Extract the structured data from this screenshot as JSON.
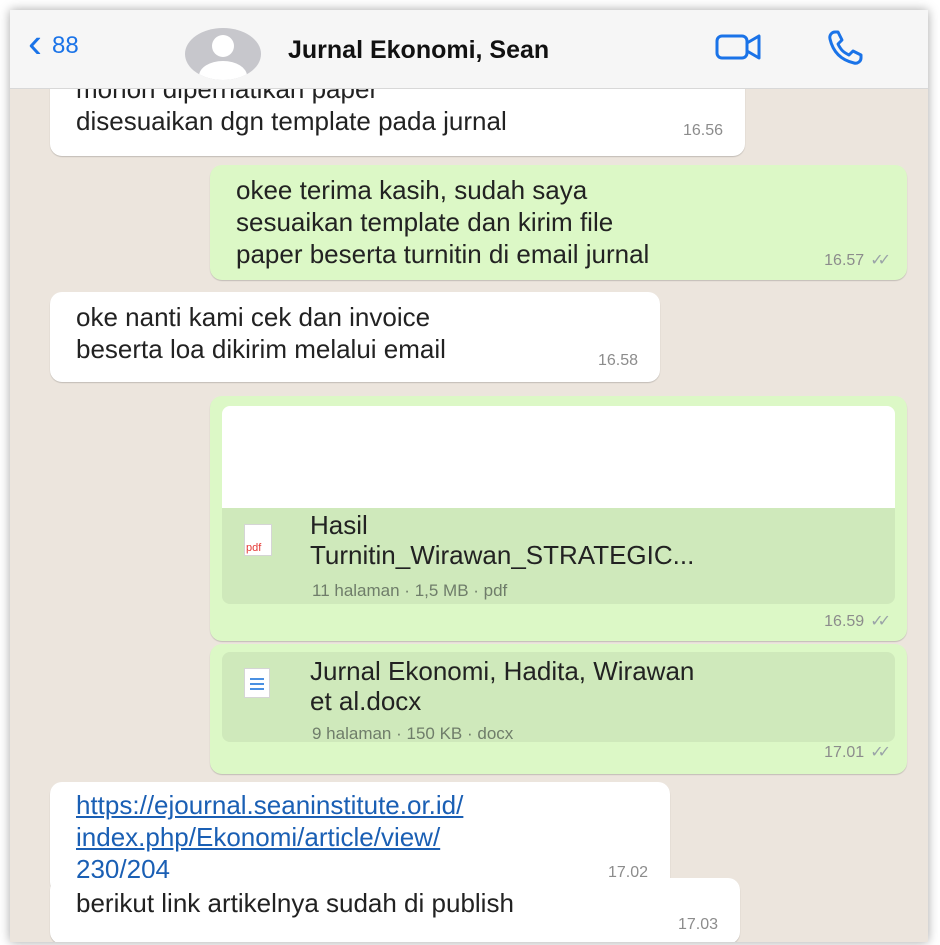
{
  "header": {
    "back_count": "88",
    "title": "Jurnal Ekonomi, Sean"
  },
  "messages": [
    {
      "type": "in",
      "lines": [
        "mohon diperhatikan paper",
        "disesuaikan dgn template pada jurnal"
      ],
      "time": "16.56"
    },
    {
      "type": "out",
      "lines": [
        "okee terima kasih, sudah saya",
        "sesuaikan template dan kirim file",
        "paper beserta turnitin di email jurnal"
      ],
      "time": "16.57"
    },
    {
      "type": "in",
      "lines": [
        "oke nanti kami cek dan invoice",
        "beserta loa dikirim melalui email"
      ],
      "time": "16.58"
    },
    {
      "type": "out-doc",
      "icon_label": "pdf",
      "name_lines": [
        "Hasil",
        "Turnitin_Wirawan_STRATEGIC..."
      ],
      "meta": "11 halaman · 1,5 MB · pdf",
      "time": "16.59"
    },
    {
      "type": "out-doc",
      "name_lines": [
        "Jurnal Ekonomi, Hadita, Wirawan",
        "et al.docx"
      ],
      "meta": "9 halaman · 150 KB · docx",
      "time": "17.01"
    },
    {
      "type": "in-link",
      "lines": [
        "https://ejournal.seaninstitute.or.id/",
        "index.php/Ekonomi/article/view/",
        "230/204"
      ],
      "time": "17.02"
    },
    {
      "type": "in",
      "lines": [
        "berikut link artikelnya sudah di publish"
      ],
      "time": "17.03"
    }
  ],
  "colors": {
    "incoming": "#ffffff",
    "outgoing": "#dcf8c6",
    "wallpaper": "#ece5dd",
    "accent": "#1a73e8",
    "pdf": "#e53935"
  },
  "icons": [
    "chevron-left-icon",
    "avatar-icon",
    "video-call-icon",
    "phone-icon",
    "pdf-icon",
    "doc-icon",
    "double-check-icon"
  ]
}
